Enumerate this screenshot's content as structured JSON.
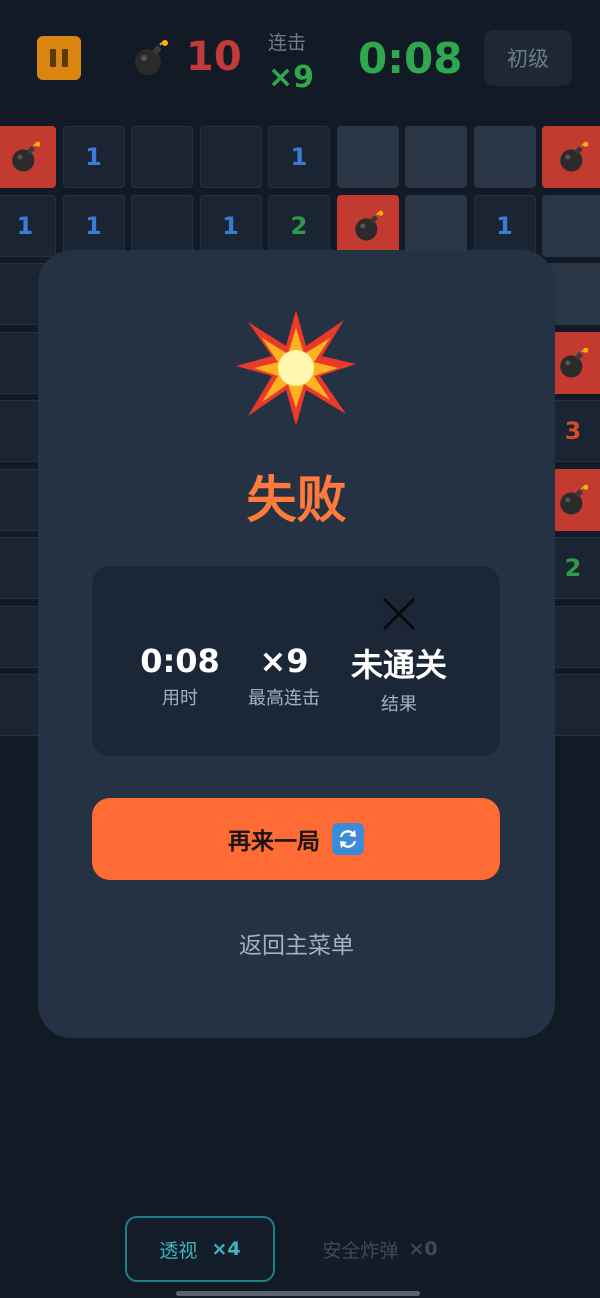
{
  "header": {
    "mine_count": "10",
    "combo_label": "连击",
    "combo_value": "×9",
    "timer": "0:08",
    "level": "初级"
  },
  "board": {
    "rows": [
      [
        {
          "t": "mine"
        },
        {
          "t": "open",
          "n": "1"
        },
        {
          "t": "open"
        },
        {
          "t": "open"
        },
        {
          "t": "open",
          "n": "1"
        },
        {
          "t": "closed"
        },
        {
          "t": "closed"
        },
        {
          "t": "closed"
        },
        {
          "t": "mine"
        }
      ],
      [
        {
          "t": "open",
          "n": "1"
        },
        {
          "t": "open",
          "n": "1"
        },
        {
          "t": "open"
        },
        {
          "t": "open",
          "n": "1"
        },
        {
          "t": "open",
          "n": "2"
        },
        {
          "t": "mine"
        },
        {
          "t": "closed"
        },
        {
          "t": "open",
          "n": "1"
        },
        {
          "t": "closed"
        }
      ],
      [
        {
          "t": "open"
        },
        {
          "t": "open"
        },
        {
          "t": "open"
        },
        {
          "t": "open"
        },
        {
          "t": "open"
        },
        {
          "t": "open"
        },
        {
          "t": "open"
        },
        {
          "t": "open"
        },
        {
          "t": "closed"
        }
      ],
      [
        {
          "t": "open"
        },
        {
          "t": "open"
        },
        {
          "t": "open"
        },
        {
          "t": "open"
        },
        {
          "t": "open"
        },
        {
          "t": "open"
        },
        {
          "t": "open"
        },
        {
          "t": "open"
        },
        {
          "t": "mine"
        }
      ],
      [
        {
          "t": "open"
        },
        {
          "t": "open"
        },
        {
          "t": "open"
        },
        {
          "t": "open"
        },
        {
          "t": "open"
        },
        {
          "t": "open"
        },
        {
          "t": "open"
        },
        {
          "t": "open"
        },
        {
          "t": "open",
          "n": "3"
        }
      ],
      [
        {
          "t": "open"
        },
        {
          "t": "open"
        },
        {
          "t": "open"
        },
        {
          "t": "open"
        },
        {
          "t": "open"
        },
        {
          "t": "open"
        },
        {
          "t": "open"
        },
        {
          "t": "open"
        },
        {
          "t": "mine"
        }
      ],
      [
        {
          "t": "open"
        },
        {
          "t": "open"
        },
        {
          "t": "open"
        },
        {
          "t": "open"
        },
        {
          "t": "open"
        },
        {
          "t": "open"
        },
        {
          "t": "open"
        },
        {
          "t": "open"
        },
        {
          "t": "open",
          "n": "2"
        }
      ],
      [
        {
          "t": "open"
        },
        {
          "t": "open"
        },
        {
          "t": "open"
        },
        {
          "t": "open"
        },
        {
          "t": "open"
        },
        {
          "t": "open"
        },
        {
          "t": "open"
        },
        {
          "t": "open"
        },
        {
          "t": "open"
        }
      ],
      [
        {
          "t": "open"
        },
        {
          "t": "open"
        },
        {
          "t": "open"
        },
        {
          "t": "open"
        },
        {
          "t": "open"
        },
        {
          "t": "open"
        },
        {
          "t": "open"
        },
        {
          "t": "open"
        },
        {
          "t": "open"
        }
      ]
    ]
  },
  "result": {
    "icon": "explosion-icon",
    "title": "失败",
    "stats": {
      "time_value": "0:08",
      "time_label": "用时",
      "combo_value": "×9",
      "combo_label": "最高连击",
      "result_icon": "x-icon",
      "result_value": "未通关",
      "result_label": "结果"
    },
    "retry_label": "再来一局",
    "retry_icon": "refresh-icon",
    "menu_label": "返回主菜单"
  },
  "powerups": {
    "xray_label": "透视",
    "xray_count": "×4",
    "safe_label": "安全炸弹",
    "safe_count": "×0"
  },
  "colors": {
    "accent_orange": "#ff6b35",
    "mine_red": "#c23a30",
    "timer_green": "#2fa84f",
    "panel_bg": "#243244"
  }
}
